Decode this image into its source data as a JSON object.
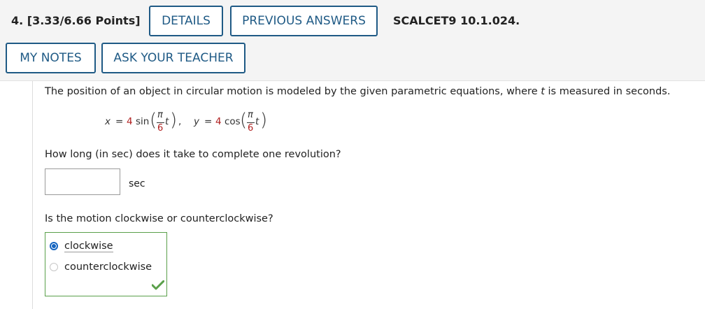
{
  "header": {
    "question_label": "4.  [3.33/6.66 Points]",
    "details_button": "DETAILS",
    "previous_answers_button": "PREVIOUS ANSWERS",
    "source": "SCALCET9 10.1.024.",
    "my_notes_button": "MY NOTES",
    "ask_teacher_button": "ASK YOUR TEACHER"
  },
  "question": {
    "intro_before": "The position of an object in circular motion is modeled by the given parametric equations, where ",
    "intro_var": "t",
    "intro_after": " is measured in seconds.",
    "eq_x": {
      "var": "x",
      "equals": "=",
      "coef": "4",
      "func": "sin",
      "num": "π",
      "den": "6",
      "t": "t",
      "trail": ","
    },
    "eq_y": {
      "var": "y",
      "equals": "=",
      "coef": "4",
      "func": "cos",
      "num": "π",
      "den": "6",
      "t": "t"
    },
    "part1": "How long (in sec) does it take to complete one revolution?",
    "answer_value": "",
    "unit": "sec",
    "part2": "Is the motion clockwise or counterclockwise?",
    "options": [
      {
        "label": "clockwise",
        "selected": true
      },
      {
        "label": "counterclockwise",
        "selected": false
      }
    ],
    "correct_color": "#5aa04a",
    "accent_color": "#1f5a85"
  }
}
